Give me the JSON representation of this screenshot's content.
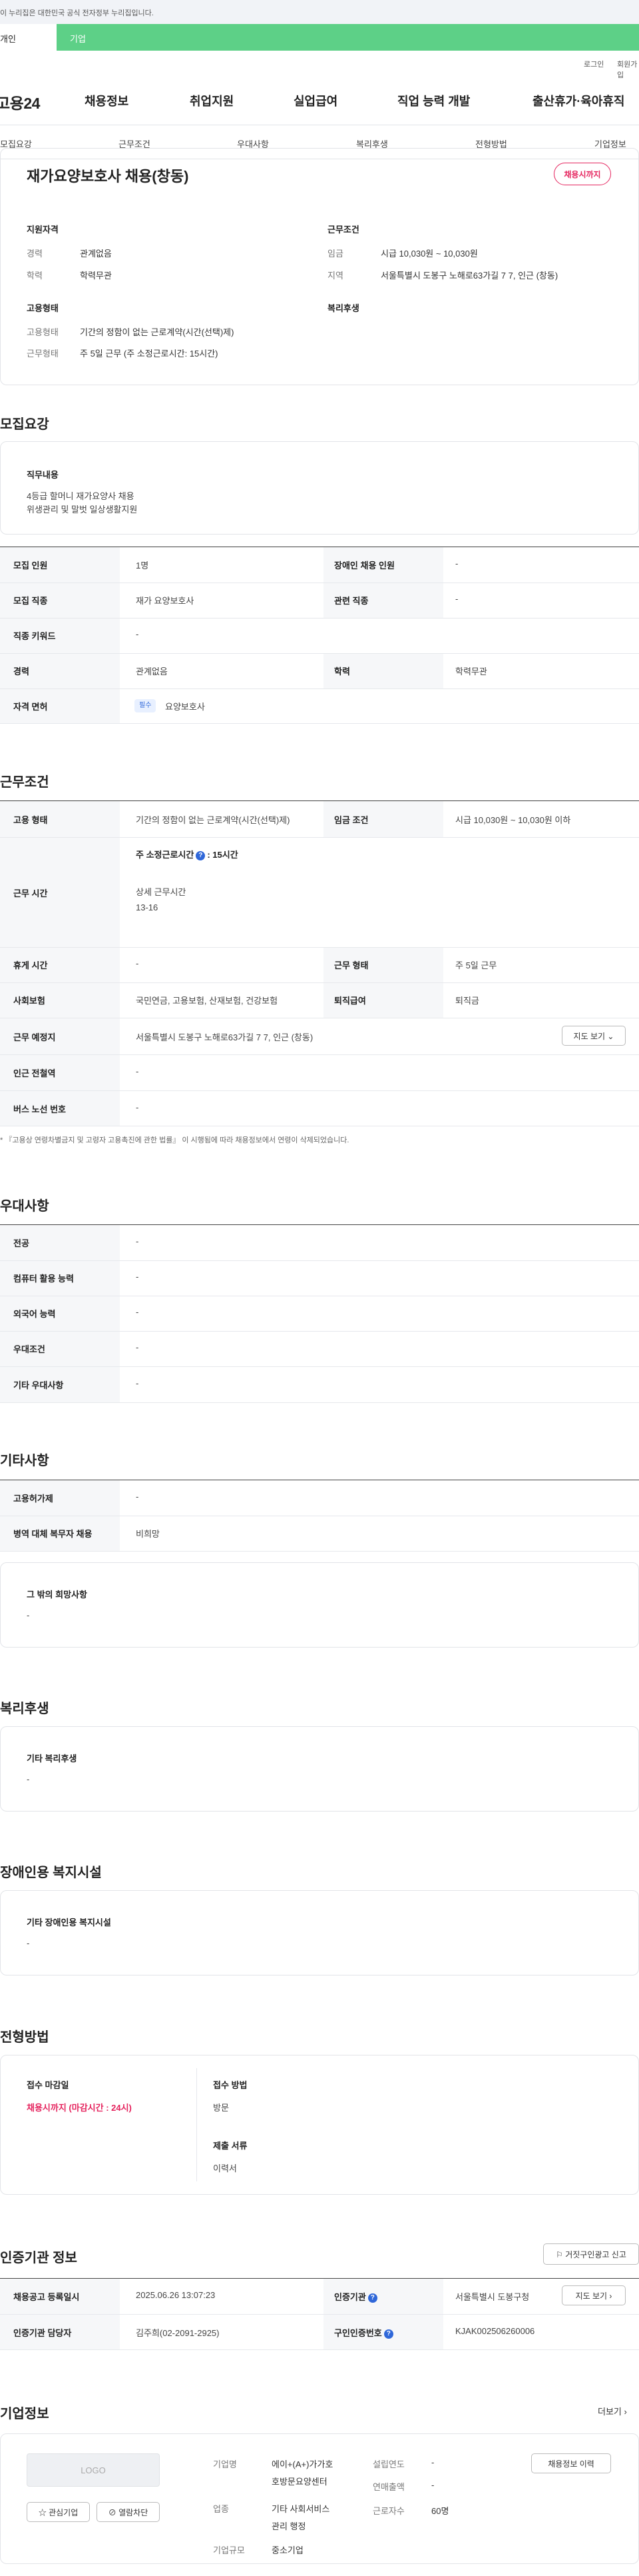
{
  "gov_banner": "이 누리집은 대한민국 공식 전자정부 누리집입니다.",
  "role_tabs": {
    "personal": "개인",
    "company": "기업"
  },
  "util": {
    "login": "로그인",
    "signup": "회원가입"
  },
  "logo": "고용24",
  "gnb": [
    "채용정보",
    "취업지원",
    "실업급여",
    "직업 능력 개발",
    "출산휴가·육아휴직"
  ],
  "subnav": [
    "모집요강",
    "근무조건",
    "우대사항",
    "복리후생",
    "전형방법",
    "기업정보"
  ],
  "summary": {
    "title": "재가요양보호사 채용(창동)",
    "badge": "채용시까지",
    "qualification": {
      "heading": "지원자격",
      "career_k": "경력",
      "career_v": "관계없음",
      "edu_k": "학력",
      "edu_v": "학력무관"
    },
    "conditions": {
      "heading": "근무조건",
      "wage_k": "임금",
      "wage_v": "시급 10,030원 ~ 10,030원",
      "region_k": "지역",
      "region_v": "서울특별시 도봉구 노해로63가길 7 7, 인근 (창동)"
    },
    "employment": {
      "heading": "고용형태",
      "type_k": "고용형태",
      "type_v": "기간의 정함이 없는 근로계약(시간(선택)제)",
      "hours_k": "근무형태",
      "hours_v": "주 5일 근무 (주 소정근로시간: 15시간)"
    },
    "welfare_heading": "복리후생"
  },
  "recruit": {
    "title": "모집요강",
    "duty_heading": "직무내용",
    "duty_lines": [
      "4등급 할머니 재가요양사 채용",
      "위생관리 및 말벗 일상생활지원"
    ],
    "rows": [
      {
        "k1": "모집 인원",
        "v1": "1명",
        "k2": "장애인 채용 인원",
        "v2": "-"
      },
      {
        "k1": "모집 직종",
        "v1": "재가 요양보호사",
        "k2": "관련 직종",
        "v2": "-"
      },
      {
        "k1": "직종 키워드",
        "v1": "-"
      },
      {
        "k1": "경력",
        "v1": "관계없음",
        "k2": "학력",
        "v2": "학력무관"
      }
    ],
    "license_k": "자격 면허",
    "license_tag": "필수",
    "license_v": "요양보호사"
  },
  "work": {
    "title": "근무조건",
    "type_k": "고용 형태",
    "type_v": "기간의 정함이 없는 근로계약(시간(선택)제)",
    "wage_k": "임금 조건",
    "wage_v": "시급 10,030원 ~ 10,030원 이하",
    "hours_k": "근무 시간",
    "hours_weekly_label": "주 소정근로시간",
    "hours_weekly_value": ": 15시간",
    "hours_detail_label": "상세 근무시간",
    "hours_detail_value": "13-16",
    "rest_k": "휴게 시간",
    "rest_v": "-",
    "form_k": "근무 형태",
    "form_v": "주 5일 근무",
    "insurance_k": "사회보험",
    "insurance_v": "국민연금, 고용보험, 산재보험, 건강보험",
    "severance_k": "퇴직급여",
    "severance_v": "퇴직금",
    "place_k": "근무 예정지",
    "place_v": "서울특별시 도봉구 노해로63가길 7 7, 인근 (창동)",
    "map_btn": "지도 보기",
    "subway_k": "인근 전철역",
    "subway_v": "-",
    "bus_k": "버스 노선 번호",
    "bus_v": "-",
    "note": "* 『고용상 연령차별금지 및 고령자 고용촉진에 관한 법률』 이 시행됨에 따라 채용정보에서 연령이 삭제되었습니다."
  },
  "pref": {
    "title": "우대사항",
    "rows": [
      {
        "k": "전공",
        "v": "-"
      },
      {
        "k": "컴퓨터 활용 능력",
        "v": "-"
      },
      {
        "k": "외국어 능력",
        "v": "-"
      },
      {
        "k": "우대조건",
        "v": "-"
      },
      {
        "k": "기타 우대사항",
        "v": "-"
      }
    ]
  },
  "etc": {
    "title": "기타사항",
    "rows": [
      {
        "k": "고용허가제",
        "v": "-"
      },
      {
        "k": "병역 대체 복무자 채용",
        "v": "비희망"
      }
    ],
    "box_heading": "그 밖의 희망사항",
    "box_v": "-"
  },
  "welfare": {
    "title": "복리후생",
    "heading": "기타 복리후생",
    "v": "-"
  },
  "disabled": {
    "title": "장애인용 복지시설",
    "heading": "기타 장애인용 복지시설",
    "v": "-"
  },
  "selection": {
    "title": "전형방법",
    "deadline_k": "접수 마감일",
    "deadline_v": "채용시까지 (마감시간 : 24시)",
    "method_k": "접수 방법",
    "method_v": "방문",
    "docs_k": "제출 서류",
    "docs_v": "이력서"
  },
  "cert": {
    "title": "인증기관 정보",
    "report_btn": "거짓구인광고 신고",
    "reg_k": "채용공고 등록일시",
    "reg_v": "2025.06.26 13:07:23",
    "agency_k": "인증기관",
    "agency_v": "서울특별시 도봉구청",
    "manager_k": "인증기관 담당자",
    "manager_v": "김주희(02-2091-2925)",
    "certno_k": "구인인증번호",
    "certno_v": "KJAK002506260006",
    "map_btn": "지도 보기"
  },
  "company": {
    "title": "기업정보",
    "more": "더보기",
    "logo": "LOGO",
    "fav_btn": "관심기업",
    "block_btn": "열람차단",
    "name_k": "기업명",
    "name_lines": [
      "에이+(A+)가가호",
      "호방문요양센터"
    ],
    "industry_k": "업종",
    "industry_lines": [
      "기타 사회서비스",
      "관리 행정"
    ],
    "size_k": "기업규모",
    "size_v": "중소기업",
    "founded_k": "설립연도",
    "founded_v": "-",
    "revenue_k": "연매출액",
    "revenue_v": "-",
    "staff_k": "근로자수",
    "staff_v": "60명",
    "history_btn": "채용정보 이력"
  }
}
